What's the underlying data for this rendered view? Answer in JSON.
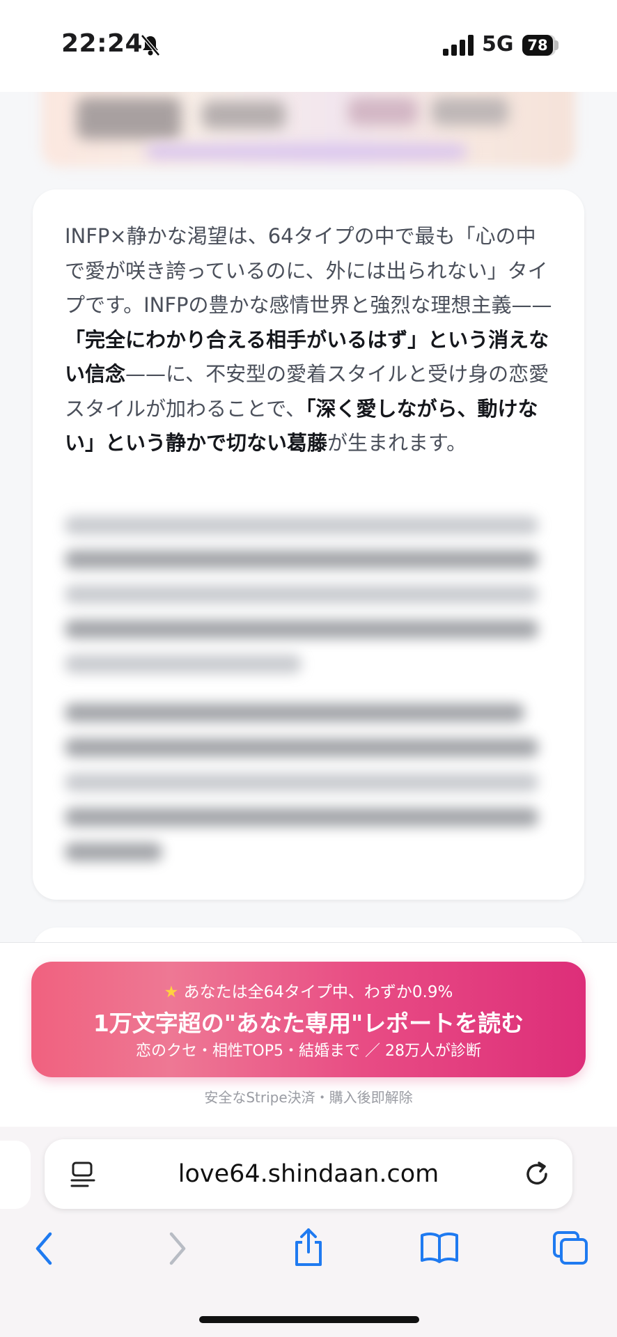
{
  "status_bar": {
    "time": "22:24",
    "network": "5G",
    "battery": "78"
  },
  "card": {
    "intro_segments": [
      "INFP×静かな渇望は、64タイプの中で最も「心の中で愛が咲き誇っているのに、外には出られない」タイプです。INFPの豊かな感情世界と強烈な理想主義——",
      "「完全にわかり合える相手がいるはず」という消えない信念",
      "——に、不安型の愛着スタイルと受け身の恋愛スタイルが加わることで、",
      "「深く愛しながら、動けない」という静かで切ない葛藤",
      "が生まれます。"
    ]
  },
  "cta": {
    "line1": "あなたは全64タイプ中、わずか0.9%",
    "line2": "1万文字超の\"あなた専用\"レポートを読む",
    "line3": "恋のクセ・相性TOP5・結婚まで ／ 28万人が診断",
    "secure_note": "安全なStripe決済・購入後即解除"
  },
  "browser": {
    "url": "love64.shindaan.com"
  }
}
